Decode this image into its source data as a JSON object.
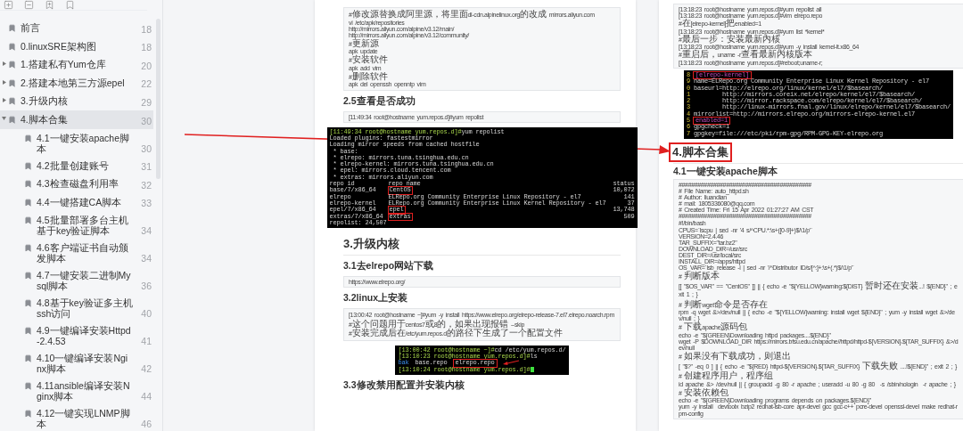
{
  "outline": [
    {
      "title": "前言",
      "page": "18",
      "selected": false
    },
    {
      "title": "0.linuxSRE架构图",
      "page": "18",
      "selected": false
    },
    {
      "title": "1.搭建私有Yum仓库",
      "page": "20",
      "selected": false,
      "expanded": false
    },
    {
      "title": "2.搭建本地第三方源epel",
      "page": "22",
      "selected": false,
      "expanded": false
    },
    {
      "title": "3.升级内核",
      "page": "29",
      "selected": false,
      "expanded": false
    },
    {
      "title": "4.脚本合集",
      "page": "30",
      "selected": true,
      "expanded": true,
      "children": [
        {
          "title": "4.1一键安装apache脚本",
          "page": "30",
          "selected": false
        },
        {
          "title": "4.2批量创建账号",
          "page": "31",
          "selected": false
        },
        {
          "title": "4.3检查磁盘利用率",
          "page": "32",
          "selected": false
        },
        {
          "title": "4.4一键搭建CA脚本",
          "page": "33",
          "selected": false
        },
        {
          "title": "4.5批量部署多台主机基于key验证脚本",
          "page": "34",
          "selected": false
        },
        {
          "title": "4.6客户端证书自动颁发脚本",
          "page": "34",
          "selected": false
        },
        {
          "title": "4.7一键安装二进制Mysql脚本",
          "page": "36",
          "selected": false
        },
        {
          "title": "4.8基于key验证多主机ssh访问",
          "page": "40",
          "selected": false
        },
        {
          "title": "4.9一键编译安装Httpd-2.4.53",
          "page": "41",
          "selected": false
        },
        {
          "title": "4.10一键编译安装Nginx脚本",
          "page": "42",
          "selected": false
        },
        {
          "title": "4.11ansible编译安装Nginx脚本",
          "page": "44",
          "selected": false
        },
        {
          "title": "4.12一键实现LNMP脚本",
          "page": "46",
          "selected": false
        }
      ]
    }
  ],
  "pages": [
    {
      "blocks": [
        {
          "kind": "code",
          "groups": [
            [
              "#修改源替换成阿里源，将里面dl-cdn.alpinelinux.org的改成 mirrors.aliyun.com",
              "vi /etc/apk/repositories",
              "http://mirrors.aliyun.com/alpine/v3.12/main/",
              "http://mirrors.aliyun.com/alpine/v3.12/community/"
            ],
            [
              "#更新源",
              "apk update"
            ],
            [
              "#安装软件",
              "apk add vim"
            ],
            [
              "#删除软件",
              "apk del openssh openntp vim"
            ]
          ]
        },
        {
          "kind": "h3",
          "text": "2.5查看是否成功"
        },
        {
          "kind": "code",
          "groups": [
            [
              "[11:49:34 root@hostname yum.repos.d]#yum repolist"
            ]
          ]
        },
        {
          "kind": "terminal",
          "lines": [
            {
              "kind": "prompt",
              "prompt": "[11:49:34 root@hostname yum.repos.d]#",
              "command": "yum repolist"
            },
            {
              "kind": "output",
              "text": "Loaded plugins: fastestmirror"
            },
            {
              "kind": "output",
              "text": "Loading mirror speeds from cached hostfile"
            },
            {
              "kind": "output",
              "text": " * base:"
            },
            {
              "kind": "output",
              "text": " * elrepo: mirrors.tuna.tsinghua.edu.cn"
            },
            {
              "kind": "output",
              "text": " * elrepo-kernel: mirrors.tuna.tsinghua.edu.cn"
            },
            {
              "kind": "output",
              "text": " * epel: mirrors.cloud.tencent.com"
            },
            {
              "kind": "output",
              "text": " * extras: mirrors.aliyun.com"
            },
            {
              "kind": "table",
              "cells": [
                {
                  "text": "repo id",
                  "boxed": false
                },
                {
                  "text": "repo name",
                  "boxed": false
                },
                {
                  "text": "status",
                  "boxed": false
                }
              ]
            },
            {
              "kind": "table",
              "cells": [
                {
                  "text": "base/7/x86_64",
                  "boxed": false
                },
                {
                  "text": "CentOS",
                  "boxed": true
                },
                {
                  "text": "10,072",
                  "boxed": false
                }
              ]
            },
            {
              "kind": "table",
              "cells": [
                {
                  "text": "elrepo",
                  "boxed": false
                },
                {
                  "text": "ELRepo.org Community Enterprise Linux Repository - el7",
                  "boxed": false
                },
                {
                  "text": "141",
                  "boxed": false
                }
              ]
            },
            {
              "kind": "table",
              "cells": [
                {
                  "text": "elrepo-kernel",
                  "boxed": false
                },
                {
                  "text": "ELRepo.org Community Enterprise Linux Kernel Repository - el7",
                  "boxed": false
                },
                {
                  "text": "37",
                  "boxed": false
                }
              ]
            },
            {
              "kind": "table",
              "cells": [
                {
                  "text": "epel/7/x86_64",
                  "boxed": false
                },
                {
                  "text": "epel",
                  "boxed": true
                },
                {
                  "text": "13,748",
                  "boxed": false
                }
              ]
            },
            {
              "kind": "table",
              "cells": [
                {
                  "text": "extras/7/x86_64",
                  "boxed": false
                },
                {
                  "text": "extras",
                  "boxed": true
                },
                {
                  "text": "509",
                  "boxed": false
                }
              ]
            },
            {
              "kind": "output",
              "text": "repolist: 24,507"
            }
          ]
        },
        {
          "kind": "h2",
          "text": "3.升级内核",
          "boxed": false
        },
        {
          "kind": "h3",
          "text": "3.1去elrepo网站下载"
        },
        {
          "kind": "code",
          "groups": [
            [
              "https://www.elrepo.org/"
            ]
          ]
        },
        {
          "kind": "h3",
          "text": "3.2linux上安装"
        },
        {
          "kind": "code",
          "groups": [
            [
              "[13:00:42 root@hostname ~]#yum -y install https://www.elrepo.org/elrepo-release-7.el7.elrepo.noarch.rpm    #这个问题用于centos7或8的，如果出现报错 --skip",
              "#安装完成后在/etc/yum.repos.d的路径下生成了一个配置文件"
            ]
          ]
        },
        {
          "kind": "terminal",
          "lines": [
            {
              "kind": "prompt",
              "prompt": "[13:00:42 root@hostname ~]#",
              "command": "cd /etc/yum.repos.d/"
            },
            {
              "kind": "prompt",
              "prompt": "[13:10:23 root@hostname yum.repos.d]#",
              "command": "ls"
            },
            {
              "kind": "files",
              "cells": [
                {
                  "text": "bak",
                  "boxed": false,
                  "kind": "directory"
                },
                {
                  "text": "base.repo",
                  "boxed": false,
                  "kind": "file"
                },
                {
                  "text": "elrepo.repo",
                  "boxed": true,
                  "kind": "file"
                }
              ]
            },
            {
              "kind": "prompt",
              "prompt": "[13:10:24 root@hostname yum.repos.d]#"
            }
          ]
        },
        {
          "kind": "h3",
          "text": "3.3修改禁用配置并安装内核"
        }
      ]
    },
    {
      "blocks": [
        {
          "kind": "code",
          "groups": [
            [
              "[13:18:23 root@hostname yum.repos.d]#yum repolist all",
              "[13:18:23 root@hostname yum.repos.d]#vim elrepo.repo",
              "#在[elrepo-kernel]把enabled=1",
              "[13:18:23 root@hostname yum.repos.d]#yum list *kernel*",
              "#最后一步：安装最新内核",
              "[13:18:23 root@hostname yum.repos.d]#yum -y install kernel-lt.x86_64",
              "#重启后，uname -r查看最新内核版本",
              "[13:18:23 root@hostname yum.repos.d]#reboot;uname-r;"
            ]
          ]
        },
        {
          "kind": "terminal",
          "lines": [
            {
              "kind": "numbered",
              "number": "8",
              "text": "[elrepo-kernel]",
              "boxed": true
            },
            {
              "kind": "numbered",
              "number": "9",
              "text": "name=ELRepo.org Community Enterprise Linux Kernel Repository - el7",
              "boxed": false
            },
            {
              "kind": "numbered",
              "number": "0",
              "text": "baseurl=http://elrepo.org/linux/kernel/el7/$basearch/",
              "boxed": false
            },
            {
              "kind": "numbered",
              "number": "1",
              "text": "        http://mirrors.coreix.net/elrepo/kernel/el7/$basearch/",
              "boxed": false
            },
            {
              "kind": "numbered",
              "number": "2",
              "text": "        http://mirror.rackspace.com/elrepo/kernel/el7/$basearch/",
              "boxed": false
            },
            {
              "kind": "numbered",
              "number": "3",
              "text": "        http://linux-mirrors.fnal.gov/linux/elrepo/kernel/el7/$basearch/",
              "boxed": false
            },
            {
              "kind": "numbered",
              "number": "4",
              "text": "mirrorlist=http://mirrors.elrepo.org/mirrors-elrepo-kernel.el7",
              "boxed": false
            },
            {
              "kind": "numbered",
              "number": "5",
              "text": "enabled=1",
              "boxed": true
            },
            {
              "kind": "numbered",
              "number": "6",
              "text": "gpgcheck=1",
              "boxed": false
            },
            {
              "kind": "numbered",
              "number": "7",
              "text": "gpgkey=file:///etc/pki/rpm-gpg/RPM-GPG-KEY-elrepo.org",
              "boxed": false
            }
          ]
        },
        {
          "kind": "h2",
          "text": "4.脚本合集",
          "boxed": true
        },
        {
          "kind": "h3",
          "text": "4.1一键安装apache脚本"
        },
        {
          "kind": "code",
          "groups": [
            [
              "##########################################",
              "# File Name: auto_httpd.sh",
              "# Author: liuandian",
              "# mail: 1805336080@qq.com",
              "# Created Time: Fri 15 Apr 2022 01:27:27 AM CST",
              "##########################################",
              "#!/bin/bash"
            ],
            [
              "CPUS=`lscpu | sed -nr '4 s/^CPU.*:\\s+([0-9]+)$/\\1/p'`",
              "VERSION=2.4.46",
              "TAR_SUFFIX=\"tar.bz2\"",
              "DOWNLOAD_DIR=/usr/src",
              "DEST_DIR=/usr/local/src",
              "INSTALL_DIR=/apps/httpd",
              "OS_VAR=`lsb_release -i | sed -nr '/^Distributor ID/s/[^:]+:\\s+(.*)$/\\1/p'`"
            ],
            [
              "# 判断版本",
              "[[ \"$OS_VAR\" == \"CentOS\" ]] || { echo -e \"${YELLOW}warning:${DIST} 暂时还在安装...! ${END}\" ; exit 1 ; }"
            ],
            [
              "# 判断wget命令是否存在",
              "rpm -q wget &>/dev/null || { echo -e \"${YELLOW}warning: install wget ${END}\" ; yum -y install wget &>/dev/null ; }"
            ],
            [
              "# 下载apache源码包",
              "echo -e \"${GREEN}Downloading httpd packages....${END}\"",
              "wget -P $DOWNLOAD_DIR https://mirrors.bfsu.edu.cn/apache//httpd/httpd-${VERSION}.${TAR_SUFFIX} &>/dev/null"
            ],
            [
              "# 如果没有下载成功，则退出",
              "[ \"$?\" -eq 0 ] || { echo -e \"${RED} httpd-${VERSION}.${TAR_SUFFIX} 下载失败 ....!${END}\" ; exit 2 ; }"
            ],
            [
              "# 创建程序用户，程序组",
              "id apache &> /dev/null || { groupadd -g 80 -r apache ; useradd -u 80 -g 80  -s /sbin/nologin  -r apache ; }"
            ],
            [
              "# 安装依赖包",
              "echo -e \"${GREEN}Downloading programs depends on packages.${END}\"",
              "yum -y install  devtoolx bzip2 redhat-lsb-core apr-devel gcc gcc-c++ pcre-devel openssl-devel make redhat-rpm-config"
            ]
          ]
        }
      ]
    }
  ]
}
